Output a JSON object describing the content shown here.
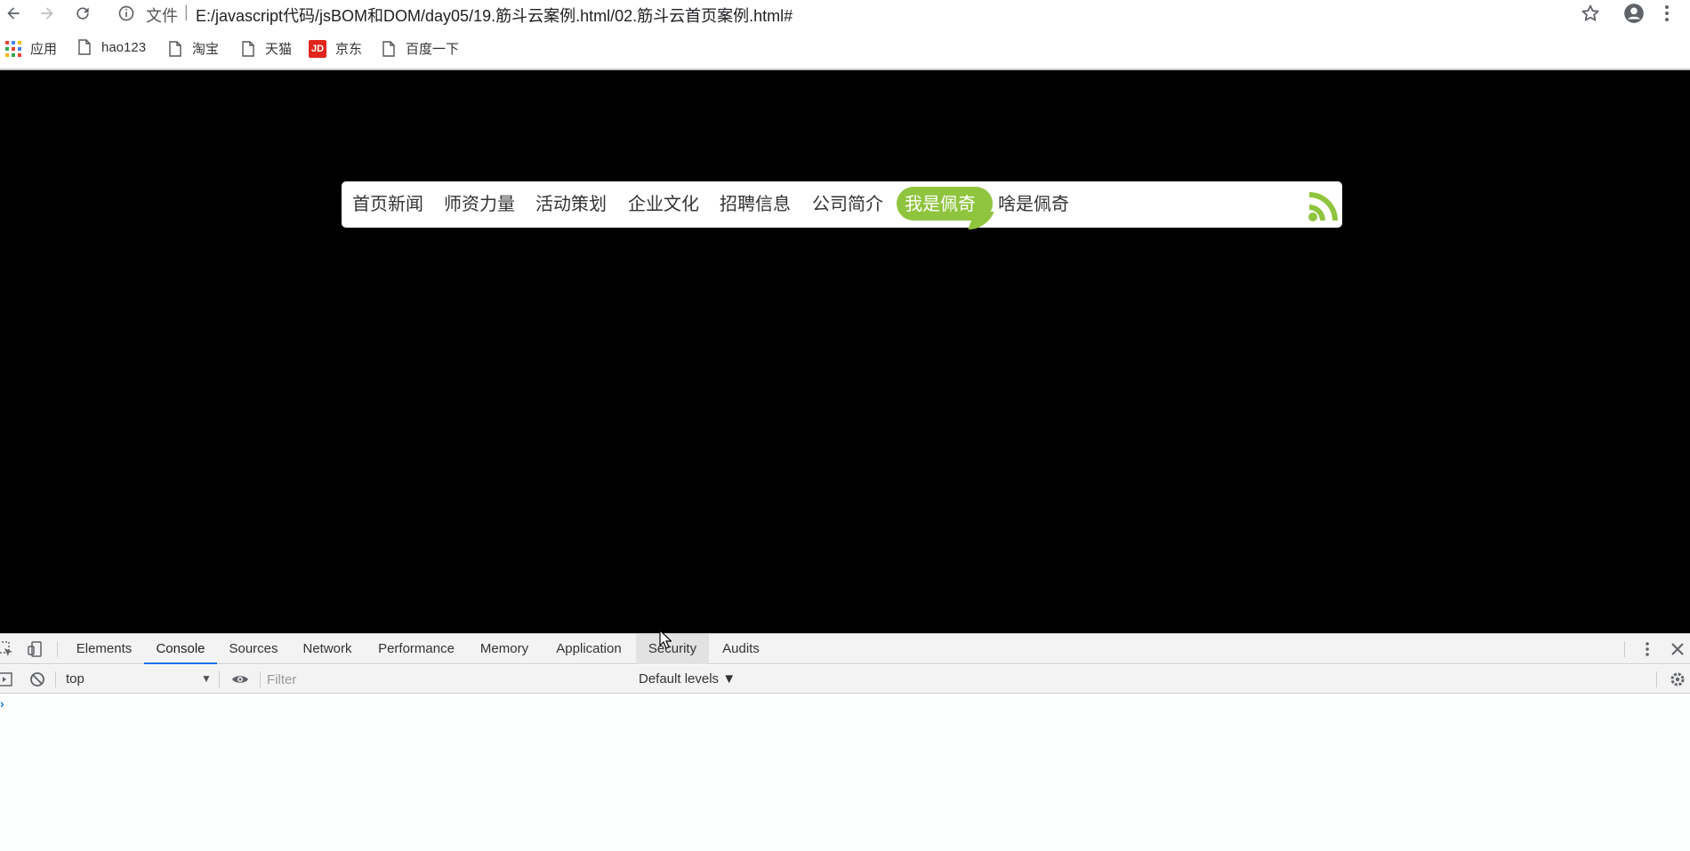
{
  "browser": {
    "url_scheme_label": "文件",
    "url_separator": "|",
    "url": "E:/javascript代码/jsBOM和DOM/day05/19.筋斗云案例.html/02.筋斗云首页案例.html#",
    "bookmarks": [
      {
        "label": "应用",
        "icon": "apps-grid-icon"
      },
      {
        "label": "hao123",
        "icon": "page-icon"
      },
      {
        "label": "淘宝",
        "icon": "page-icon"
      },
      {
        "label": "天猫",
        "icon": "page-icon"
      },
      {
        "label": "京东",
        "icon": "jd-logo-icon"
      },
      {
        "label": "百度一下",
        "icon": "page-icon"
      }
    ],
    "jd_logo_text": "JD"
  },
  "page": {
    "background": "#000000",
    "nav_items": [
      "首页新闻",
      "师资力量",
      "活动策划",
      "企业文化",
      "招聘信息",
      "公司简介",
      "我是佩奇",
      "啥是佩奇"
    ],
    "active_item_index": 6,
    "accent_color": "#8fc43e",
    "rss_icon": "rss-icon"
  },
  "devtools": {
    "tabs": [
      "Elements",
      "Console",
      "Sources",
      "Network",
      "Performance",
      "Memory",
      "Application",
      "Security",
      "Audits"
    ],
    "active_tab": "Console",
    "hover_tab": "Security",
    "context": "top",
    "filter_placeholder": "Filter",
    "levels_label": "Default levels ▼",
    "prompt_symbol": "›"
  }
}
